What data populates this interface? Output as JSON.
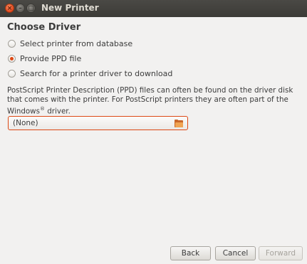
{
  "window": {
    "title": "New Printer",
    "close_glyph": "×",
    "min_glyph": "–",
    "max_glyph": "□"
  },
  "page": {
    "heading": "Choose Driver"
  },
  "options": [
    {
      "label": "Select printer from database",
      "checked": false
    },
    {
      "label": "Provide PPD file",
      "checked": true
    },
    {
      "label": "Search for a printer driver to download",
      "checked": false
    }
  ],
  "description": {
    "text": "PostScript Printer Description (PPD) files can often be found on the driver disk that comes with the printer. For PostScript printers they are often part of the Windows",
    "registered": "®",
    "tail": " driver."
  },
  "file_chooser": {
    "value": "(None)",
    "icon": "folder-icon"
  },
  "buttons": {
    "back": "Back",
    "cancel": "Cancel",
    "forward": "Forward"
  },
  "colors": {
    "accent": "#dd4814",
    "titlebar": "#3c3b37",
    "window_bg": "#f2f1f0"
  }
}
